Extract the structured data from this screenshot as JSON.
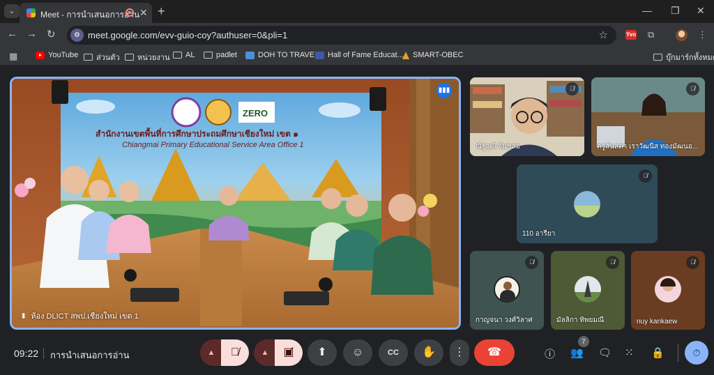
{
  "browser": {
    "tab_title": "Meet - การนำเสนอการอ่าน",
    "tab_close": "✕",
    "new_tab": "+",
    "url": "meet.google.com/evv-guio-coy?authuser=0&pli=1",
    "window_controls": {
      "minimize": "—",
      "restore": "❐",
      "close": "✕"
    },
    "ext_label": "Yvo"
  },
  "bookmarks": [
    {
      "label": "YouTube",
      "icon": "youtube-icon"
    },
    {
      "label": "ส่วนตัว",
      "icon": "folder-icon"
    },
    {
      "label": "หน่วยงาน",
      "icon": "folder-icon"
    },
    {
      "label": "AL",
      "icon": "folder-icon"
    },
    {
      "label": "padlet",
      "icon": "folder-icon"
    },
    {
      "label": "DOH TO TRAVEL",
      "icon": "doh-icon"
    },
    {
      "label": "Hall of Fame Educat...",
      "icon": "hof-icon"
    },
    {
      "label": "SMART-OBEC",
      "icon": "obec-icon"
    },
    {
      "label": "บุ๊กมาร์กทั้งหมด",
      "icon": "folder-icon"
    }
  ],
  "main_video": {
    "banner_line1": "สำนักงานเขตพื้นที่การศึกษาประถมศึกษาเชียงใหม่ เขต ๑",
    "banner_line2": "Chiangmai Primary Educational Service Area Office 1",
    "logo_text": "ZERO",
    "caption": "ห้อง DLICT สพป.เชียงใหม่ เขต 1"
  },
  "participants": [
    {
      "name": "ณัฐวุฒิ จันชลอ",
      "muted": true
    },
    {
      "name": "ครูสันลดา เราวัฒนีส ทองมัฒนอ...",
      "muted": true
    },
    {
      "name": "110 อารียา",
      "muted": true
    },
    {
      "name": "กาญจนา วงศ์วิลาศ",
      "muted": true
    },
    {
      "name": "มัลลิกา ทิพยมณี",
      "muted": true
    },
    {
      "name": "nuy kankaew",
      "muted": true
    }
  ],
  "controls": {
    "time": "09:22",
    "meeting_title": "การนำเสนอการอ่าน",
    "participant_count": "7"
  },
  "colors": {
    "accent": "#8ab4f8",
    "end_call": "#ea4335",
    "muted_bg": "#f9dedc",
    "background": "#202124"
  }
}
